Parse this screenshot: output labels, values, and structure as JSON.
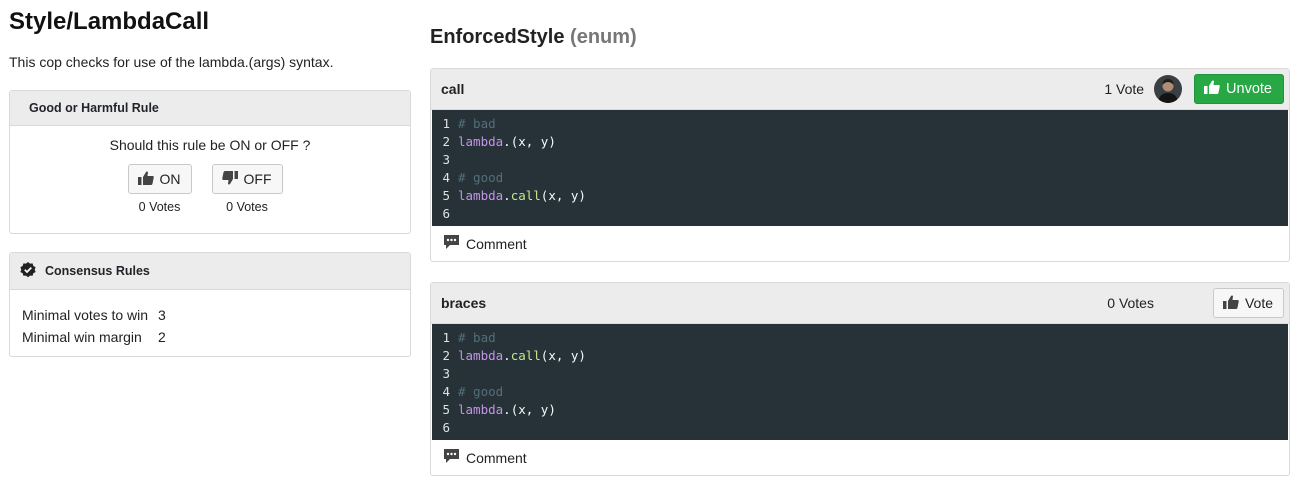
{
  "page": {
    "title": "Style/LambdaCall",
    "description": "This cop checks for use of the lambda.(args) syntax."
  },
  "rule_card": {
    "header": "Good or Harmful Rule",
    "question": "Should this rule be ON or OFF ?",
    "on_label": "ON",
    "off_label": "OFF",
    "on_votes": "0 Votes",
    "off_votes": "0 Votes"
  },
  "consensus": {
    "header": "Consensus Rules",
    "rows": [
      {
        "label": "Minimal votes to win",
        "value": "3"
      },
      {
        "label": "Minimal win margin",
        "value": "2"
      }
    ]
  },
  "enforced": {
    "title": "EnforcedStyle",
    "type": "(enum)"
  },
  "options": [
    {
      "name": "call",
      "votes": "1 Vote",
      "button": "Unvote",
      "comment": "Comment",
      "code": [
        {
          "n": "1",
          "comment": "# bad"
        },
        {
          "n": "2",
          "kw": "lambda",
          "dot": ".",
          "m": "",
          "args": "(x, y)"
        },
        {
          "n": "3"
        },
        {
          "n": "4",
          "comment": "# good"
        },
        {
          "n": "5",
          "kw": "lambda",
          "dot": ".",
          "m": "call",
          "args": "(x, y)"
        },
        {
          "n": "6"
        }
      ]
    },
    {
      "name": "braces",
      "votes": "0 Votes",
      "button": "Vote",
      "comment": "Comment",
      "code": [
        {
          "n": "1",
          "comment": "# bad"
        },
        {
          "n": "2",
          "kw": "lambda",
          "dot": ".",
          "m": "call",
          "args": "(x, y)"
        },
        {
          "n": "3"
        },
        {
          "n": "4",
          "comment": "# good"
        },
        {
          "n": "5",
          "kw": "lambda",
          "dot": ".",
          "m": "",
          "args": "(x, y)"
        },
        {
          "n": "6"
        }
      ]
    }
  ],
  "colors": {
    "code_bg": "#263238",
    "accent_green": "#28a745"
  },
  "icons": [
    "thumbs-up-icon",
    "thumbs-down-icon",
    "check-circle-icon",
    "comment-icon",
    "avatar"
  ]
}
